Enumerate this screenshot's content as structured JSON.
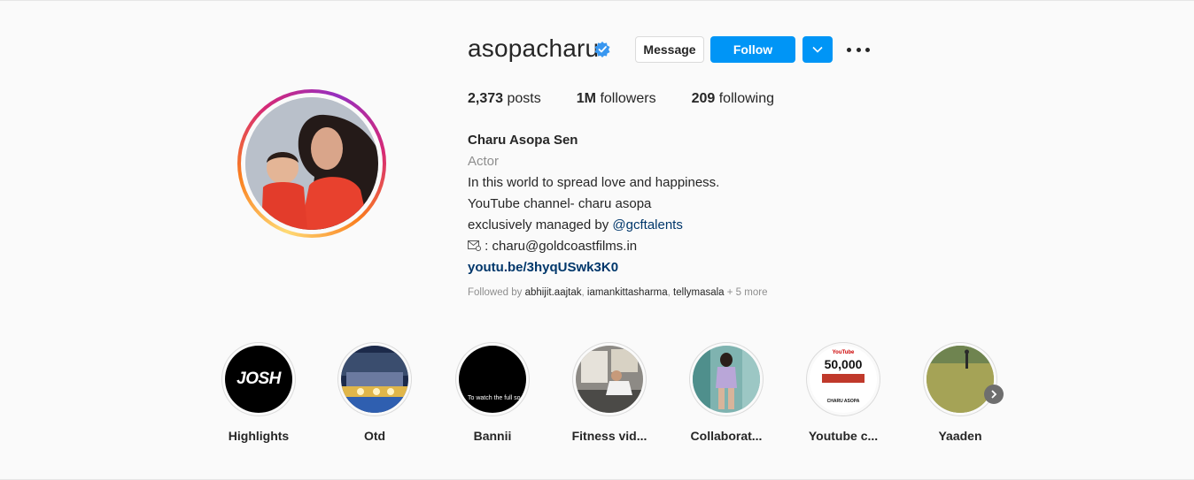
{
  "profile": {
    "username": "asopacharu",
    "verified": true,
    "buttons": {
      "message": "Message",
      "follow": "Follow"
    },
    "stats": {
      "posts_count": "2,373",
      "posts_label": "posts",
      "followers_count": "1M",
      "followers_label": "followers",
      "following_count": "209",
      "following_label": "following"
    },
    "bio": {
      "name": "Charu Asopa Sen",
      "category": "Actor",
      "line1": "In this world to spread love and happiness.",
      "line2": "YouTube channel- charu asopa",
      "line3_prefix": "exclusively managed by ",
      "line3_mention": "@gcftalents",
      "email_text": ": charu@goldcoastfilms.in",
      "link": "youtu.be/3hyqUSwk3K0"
    },
    "followed_by": {
      "prefix": "Followed by ",
      "user1": "abhijit.aajtak",
      "user2": "iamankittasharma",
      "user3": "tellymasala",
      "more": " + 5 more"
    }
  },
  "highlights": [
    {
      "label": "Highlights",
      "cover_text": "JOSH"
    },
    {
      "label": "Otd"
    },
    {
      "label": "Bannii",
      "cover_text": "To watch the full so..."
    },
    {
      "label": "Fitness vid..."
    },
    {
      "label": "Collaborat..."
    },
    {
      "label": "Youtube c...",
      "cover_text": "50,000",
      "cover_sub": "CHARU ASOPA",
      "cover_top": "YouTube"
    },
    {
      "label": "Yaaden"
    }
  ],
  "colors": {
    "accent": "#0095f6",
    "link": "#00376b",
    "muted": "#8e8e8e"
  }
}
